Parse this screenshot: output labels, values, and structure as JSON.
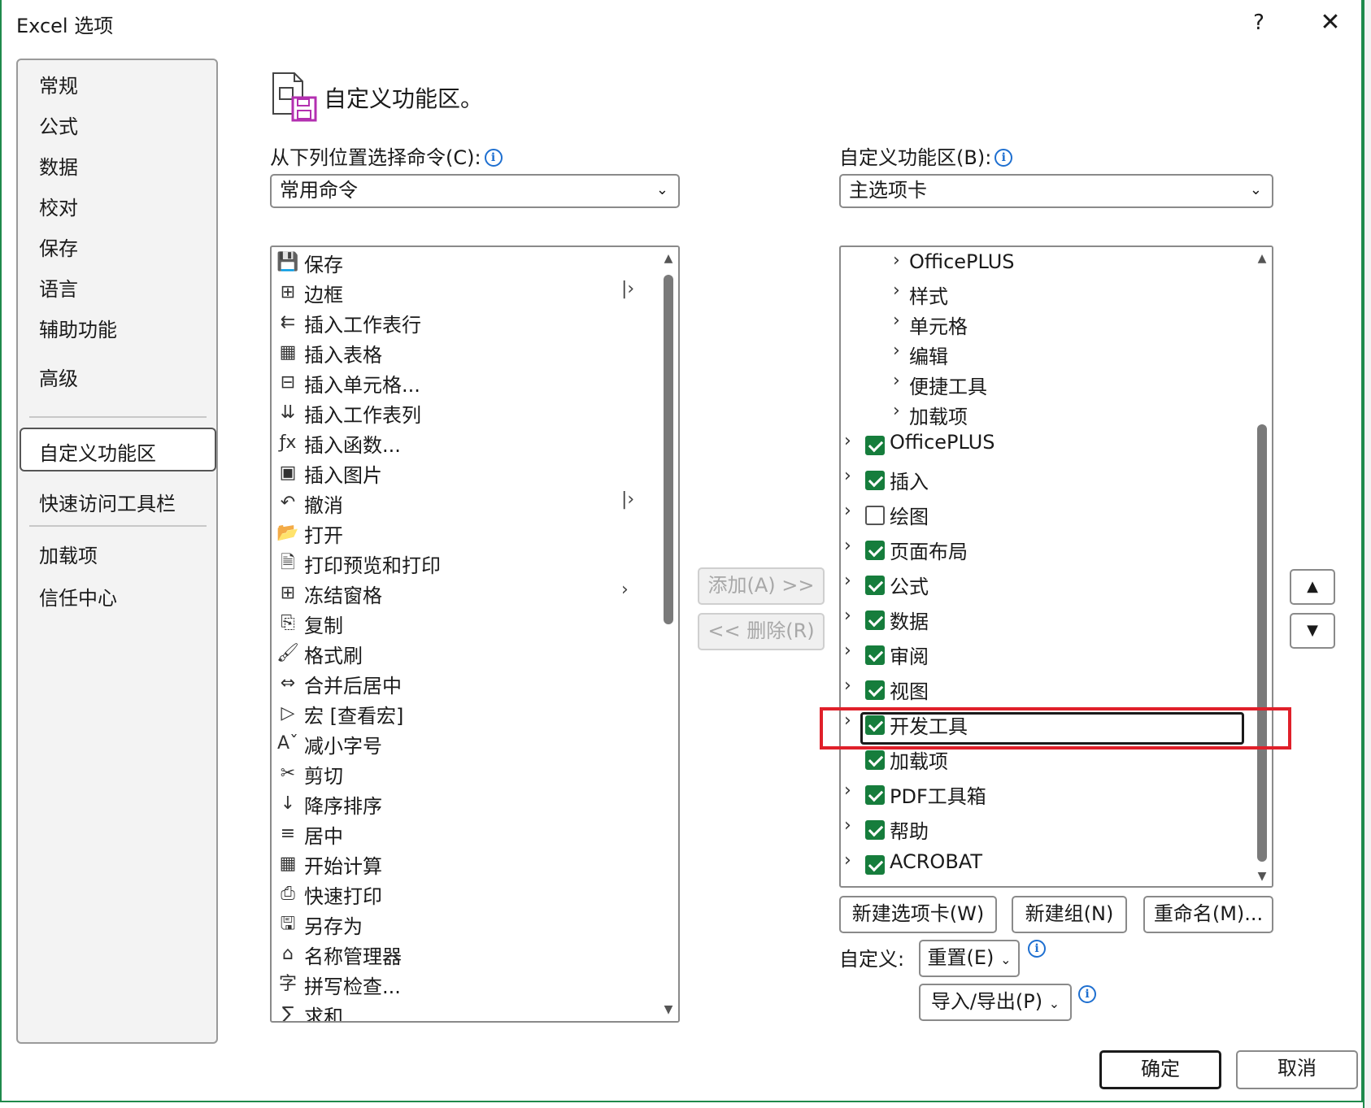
{
  "window": {
    "title": "Excel 选项",
    "help": "?",
    "close": "✕"
  },
  "nav": {
    "items": [
      "常规",
      "公式",
      "数据",
      "校对",
      "保存",
      "语言",
      "辅助功能",
      "高级",
      "自定义功能区",
      "快速访问工具栏",
      "加载项",
      "信任中心"
    ],
    "selected": "自定义功能区"
  },
  "header": {
    "title": "自定义功能区。"
  },
  "left": {
    "label": "从下列位置选择命令(C):",
    "select_value": "常用命令",
    "commands": [
      {
        "label": "保存",
        "icon": "💾",
        "sub": ""
      },
      {
        "label": "边框",
        "icon": "⊞",
        "sub": "|›"
      },
      {
        "label": "插入工作表行",
        "icon": "⇇",
        "sub": ""
      },
      {
        "label": "插入表格",
        "icon": "▦",
        "sub": ""
      },
      {
        "label": "插入单元格...",
        "icon": "⊟",
        "sub": ""
      },
      {
        "label": "插入工作表列",
        "icon": "⇊",
        "sub": ""
      },
      {
        "label": "插入函数...",
        "icon": "ƒx",
        "sub": ""
      },
      {
        "label": "插入图片",
        "icon": "▣",
        "sub": ""
      },
      {
        "label": "撤消",
        "icon": "↶",
        "sub": "|›"
      },
      {
        "label": "打开",
        "icon": "📂",
        "sub": ""
      },
      {
        "label": "打印预览和打印",
        "icon": "🗎",
        "sub": ""
      },
      {
        "label": "冻结窗格",
        "icon": "⊞",
        "sub": "›"
      },
      {
        "label": "复制",
        "icon": "⎘",
        "sub": ""
      },
      {
        "label": "格式刷",
        "icon": "🖌",
        "sub": ""
      },
      {
        "label": "合并后居中",
        "icon": "⇔",
        "sub": ""
      },
      {
        "label": "宏 [查看宏]",
        "icon": "▷",
        "sub": ""
      },
      {
        "label": "减小字号",
        "icon": "Aˇ",
        "sub": ""
      },
      {
        "label": "剪切",
        "icon": "✂",
        "sub": ""
      },
      {
        "label": "降序排序",
        "icon": "↓",
        "sub": ""
      },
      {
        "label": "居中",
        "icon": "≡",
        "sub": ""
      },
      {
        "label": "开始计算",
        "icon": "▦",
        "sub": ""
      },
      {
        "label": "快速打印",
        "icon": "⎙",
        "sub": ""
      },
      {
        "label": "另存为",
        "icon": "🖫",
        "sub": ""
      },
      {
        "label": "名称管理器",
        "icon": "⌂",
        "sub": ""
      },
      {
        "label": "拼写检查...",
        "icon": "字",
        "sub": ""
      },
      {
        "label": "求和",
        "icon": "∑",
        "sub": ""
      }
    ]
  },
  "middle": {
    "add": "添加(A) >>",
    "remove": "<< 删除(R)"
  },
  "right": {
    "label": "自定义功能区(B):",
    "select_value": "主选项卡",
    "groups": [
      {
        "label": "OfficePLUS"
      },
      {
        "label": "样式"
      },
      {
        "label": "单元格"
      },
      {
        "label": "编辑"
      },
      {
        "label": "便捷工具"
      },
      {
        "label": "加载项"
      }
    ],
    "tabs": [
      {
        "label": "OfficePLUS",
        "checked": true,
        "expander": true
      },
      {
        "label": "插入",
        "checked": true,
        "expander": true
      },
      {
        "label": "绘图",
        "checked": false,
        "expander": true
      },
      {
        "label": "页面布局",
        "checked": true,
        "expander": true
      },
      {
        "label": "公式",
        "checked": true,
        "expander": true
      },
      {
        "label": "数据",
        "checked": true,
        "expander": true
      },
      {
        "label": "审阅",
        "checked": true,
        "expander": true
      },
      {
        "label": "视图",
        "checked": true,
        "expander": true
      },
      {
        "label": "开发工具",
        "checked": true,
        "expander": true
      },
      {
        "label": "加载项",
        "checked": true,
        "expander": false
      },
      {
        "label": "PDF工具箱",
        "checked": true,
        "expander": true
      },
      {
        "label": "帮助",
        "checked": true,
        "expander": true
      },
      {
        "label": "ACROBAT",
        "checked": true,
        "expander": true
      }
    ],
    "new_tab": "新建选项卡(W)",
    "new_group": "新建组(N)",
    "rename": "重命名(M)...",
    "customize_label": "自定义:",
    "reset": "重置(E)",
    "import_export": "导入/导出(P)"
  },
  "footer": {
    "ok": "确定",
    "cancel": "取消"
  },
  "colors": {
    "checked": "#167d3c",
    "highlight": "#e0202a",
    "info": "#1e6fd0"
  }
}
